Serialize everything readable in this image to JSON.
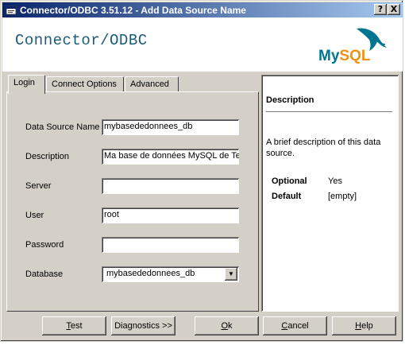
{
  "window": {
    "title": "Connector/ODBC 3.51.12 - Add Data Source Name",
    "help_glyph": "?",
    "close_glyph": "X"
  },
  "banner": {
    "title": "Connector/ODBC",
    "logo_my": "My",
    "logo_sql": "SQL"
  },
  "tabs": [
    {
      "label": "Login"
    },
    {
      "label": "Connect Options"
    },
    {
      "label": "Advanced"
    }
  ],
  "form": {
    "dsn_label": "Data Source Name",
    "dsn_value": "mybasededonnees_db",
    "description_label": "Description",
    "description_value": "Ma base de données MySQL de Te",
    "server_label": "Server",
    "server_value": "",
    "user_label": "User",
    "user_value": "root",
    "password_label": "Password",
    "password_value": "",
    "database_label": "Database",
    "database_value": "mybasededonnees_db"
  },
  "description_pane": {
    "heading": "Description",
    "text": "A brief description of this data source.",
    "optional_label": "Optional",
    "optional_value": "Yes",
    "default_label": "Default",
    "default_value": "[empty]"
  },
  "buttons": {
    "test_first": "T",
    "test_rest": "est",
    "diagnostics": "Diagnostics >>",
    "ok_first": "O",
    "ok_rest": "k",
    "cancel_first": "C",
    "cancel_rest": "ancel",
    "help_first": "H",
    "help_rest": "elp"
  },
  "colors": {
    "banner_title": "#1a5c78",
    "mysql_blue": "#00758f",
    "mysql_orange": "#f29111",
    "titlebar_start": "#0a246a",
    "titlebar_end": "#a6caf0"
  },
  "icons": [
    "app-icon",
    "dolphin-icon",
    "dropdown-arrow-icon"
  ]
}
